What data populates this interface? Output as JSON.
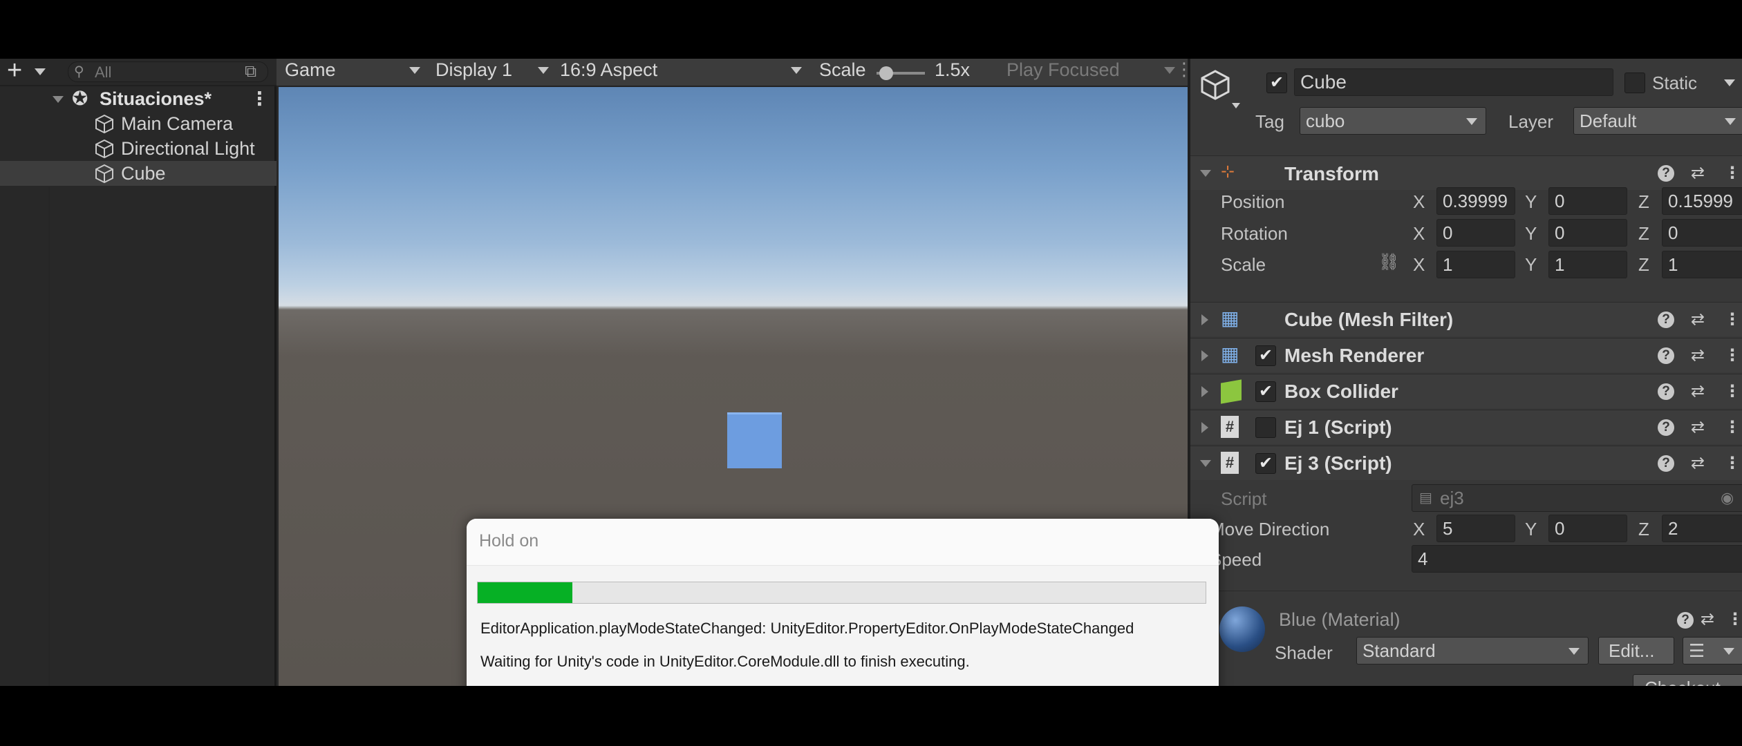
{
  "hierarchy": {
    "add_label": "+",
    "search_placeholder": "All",
    "scene_name": "Situaciones*",
    "items": [
      {
        "label": "Main Camera",
        "selected": false
      },
      {
        "label": "Directional Light",
        "selected": false
      },
      {
        "label": "Cube",
        "selected": true
      }
    ]
  },
  "game_view": {
    "view_select": "Game",
    "display_select": "Display 1",
    "aspect_select": "16:9 Aspect",
    "scale_label": "Scale",
    "scale_value": "1.5x",
    "play_mode": "Play Focused"
  },
  "inspector": {
    "object_name": "Cube",
    "active": true,
    "static_label": "Static",
    "static": false,
    "tag_label": "Tag",
    "tag_value": "cubo",
    "layer_label": "Layer",
    "layer_value": "Default",
    "transform": {
      "title": "Transform",
      "position_label": "Position",
      "rotation_label": "Rotation",
      "scale_label": "Scale",
      "position": {
        "x": "0.39999",
        "y": "0",
        "z": "0.15999"
      },
      "rotation": {
        "x": "0",
        "y": "0",
        "z": "0"
      },
      "scale": {
        "x": "1",
        "y": "1",
        "z": "1"
      },
      "axis_x": "X",
      "axis_y": "Y",
      "axis_z": "Z"
    },
    "components": [
      {
        "title": "Cube (Mesh Filter)",
        "has_checkbox": false,
        "checked": false
      },
      {
        "title": "Mesh Renderer",
        "has_checkbox": true,
        "checked": true
      },
      {
        "title": "Box Collider",
        "has_checkbox": true,
        "checked": true
      },
      {
        "title": "Ej 1 (Script)",
        "has_checkbox": true,
        "checked": false
      },
      {
        "title": "Ej 3 (Script)",
        "has_checkbox": true,
        "checked": true
      }
    ],
    "ej3": {
      "script_label": "Script",
      "script_value": "ej3",
      "move_label": "Move Direction",
      "move": {
        "x": "5",
        "y": "0",
        "z": "2"
      },
      "speed_label": "Speed",
      "speed_value": "4"
    },
    "material": {
      "title": "Blue (Material)",
      "shader_label": "Shader",
      "shader_value": "Standard",
      "edit_label": "Edit...",
      "checkout_label": "Checkout"
    }
  },
  "dialog": {
    "title": "Hold on",
    "progress_fraction": 0.13,
    "line1": "EditorApplication.playModeStateChanged: UnityEditor.PropertyEditor.OnPlayModeStateChanged",
    "line2": "Waiting for Unity's code in UnityEditor.CoreModule.dll to finish executing."
  },
  "colors": {
    "progress": "#06b025",
    "cube": "#6d9de0",
    "editor_bg": "#383838"
  }
}
